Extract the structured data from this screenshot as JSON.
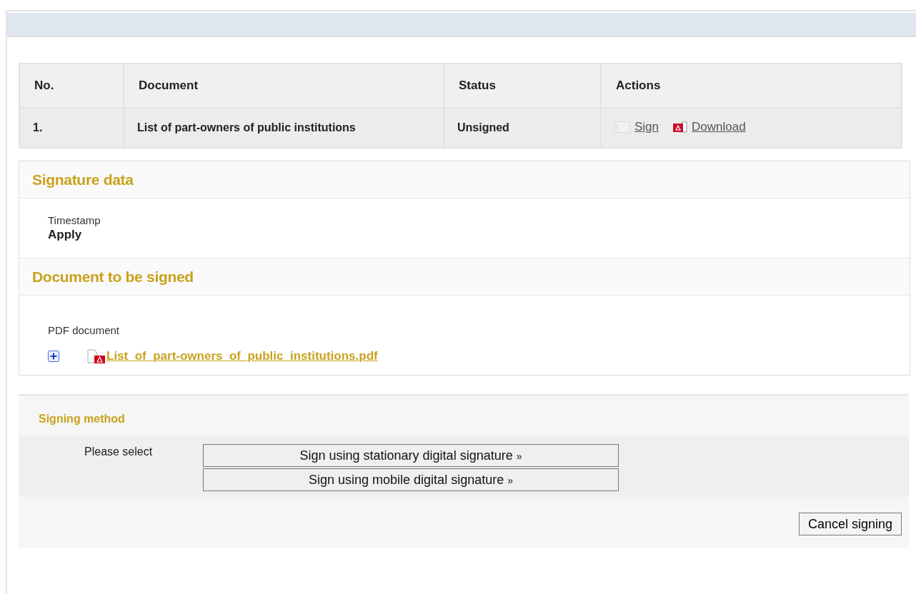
{
  "table": {
    "columns": [
      "No.",
      "Document",
      "Status",
      "Actions"
    ],
    "rows": [
      {
        "no": "1.",
        "document": "List of part-owners of public institutions",
        "status": "Unsigned",
        "actions": [
          {
            "kind": "sign",
            "label": "Sign"
          },
          {
            "kind": "download",
            "label": "Download"
          }
        ]
      }
    ]
  },
  "sections": [
    {
      "title": "Signature data",
      "kind": "field",
      "label": "Timestamp",
      "value": "Apply"
    },
    {
      "title": "Document to be signed",
      "kind": "file",
      "label": "PDF document",
      "file": "List_of_part-owners_of_public_institutions.pdf"
    }
  ],
  "signing_method": {
    "title": "Signing method",
    "prompt": "Please select",
    "options": [
      {
        "label": "Sign using stationary digital signature",
        "arrow": "»"
      },
      {
        "label": "Sign using mobile digital signature",
        "arrow": "»"
      }
    ],
    "cancel": "Cancel signing"
  }
}
